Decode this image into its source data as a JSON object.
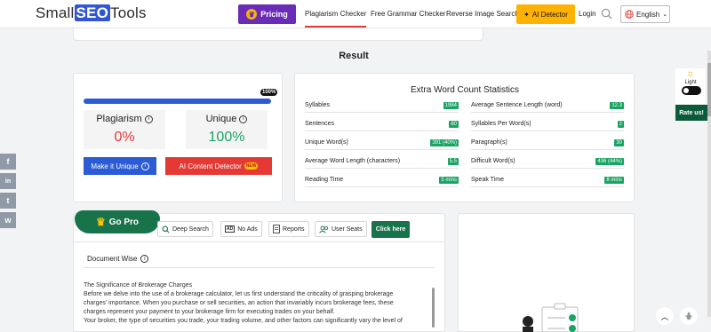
{
  "header": {
    "logo_prefix": "Small",
    "logo_seo": "SEO",
    "logo_suffix": "Tools",
    "pricing_label": "Pricing",
    "nav": [
      "Plagiarism Checker",
      "Free Grammar Checker",
      "Reverse Image Search"
    ],
    "ai_detector_label": "AI Detector",
    "login_label": "Login",
    "language": "English"
  },
  "result": {
    "title": "Result",
    "progress_label": "100%",
    "progress_value": 1.0,
    "plagiarism_label": "Plagiarism",
    "plagiarism_value": "0%",
    "unique_label": "Unique",
    "unique_value": "100%",
    "make_unique_label": "Make it Unique",
    "ai_content_label": "AI Content Detector",
    "new_badge": "NEW"
  },
  "stats": {
    "title": "Extra Word Count Statistics",
    "left": [
      {
        "label": "Syllables",
        "value": "1984"
      },
      {
        "label": "Sentences",
        "value": "80"
      },
      {
        "label": "Unique Word(s)",
        "value": "391 (40%)"
      },
      {
        "label": "Average Word Length (characters)",
        "value": "5.5"
      },
      {
        "label": "Reading Time",
        "value": "5 mins"
      }
    ],
    "right": [
      {
        "label": "Average Sentence Length (word)",
        "value": "12.3"
      },
      {
        "label": "Syllables Per Word(s)",
        "value": "2"
      },
      {
        "label": "Paragraph(s)",
        "value": "30"
      },
      {
        "label": "Difficult Word(s)",
        "value": "436 (44%)"
      },
      {
        "label": "Speak Time",
        "value": "8 mins"
      }
    ]
  },
  "gopro": {
    "tab_label": "Go Pro",
    "features": [
      "Deep Search",
      "No Ads",
      "Reports",
      "User Seats"
    ],
    "click_here": "Click here",
    "document_wise": "Document Wise",
    "doc_lines": [
      "The Significance of Brokerage Charges",
      "Before we delve into the use of a brokerage calculator, let us first understand the criticality of grasping brokerage",
      "charges' importance. When you purchase or sell securities, an action that invariably incurs brokerage fees, these",
      "charges represent your payment to your brokerage firm for executing trades on your behalf.",
      "Your broker, the type of securities you trade, your trading volume, and other factors can significantly vary the level of"
    ]
  },
  "side": {
    "mode_label": "Light Mode",
    "rate_us": "Rate us!"
  },
  "social": [
    "f",
    "in",
    "t",
    "w"
  ]
}
